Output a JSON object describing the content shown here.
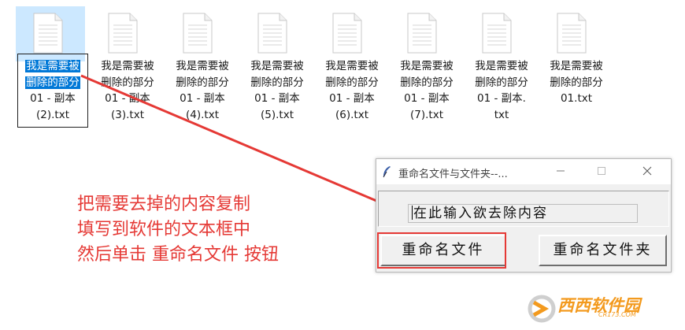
{
  "files": [
    {
      "lines": [
        "我是需要被",
        "删除的部分",
        "01 - 副本",
        "(2).txt"
      ],
      "selected": true
    },
    {
      "lines": [
        "我是需要被",
        "删除的部分",
        "01 - 副本",
        "(3).txt"
      ]
    },
    {
      "lines": [
        "我是需要被",
        "删除的部分",
        "01 - 副本",
        "(4).txt"
      ]
    },
    {
      "lines": [
        "我是需要被",
        "删除的部分",
        "01 - 副本",
        "(5).txt"
      ]
    },
    {
      "lines": [
        "我是需要被",
        "删除的部分",
        "01 - 副本",
        "(6).txt"
      ]
    },
    {
      "lines": [
        "我是需要被",
        "删除的部分",
        "01 - 副本",
        "(7).txt"
      ]
    },
    {
      "lines": [
        "我是需要被",
        "删除的部分",
        "01 - 副本.",
        "txt"
      ]
    },
    {
      "lines": [
        "我是需要被",
        "删除的部分",
        "01.txt"
      ]
    }
  ],
  "instructions": {
    "line1": "把需要去掉的内容复制",
    "line2": "填写到软件的文本框中",
    "line3": "然后单击 重命名文件 按钮"
  },
  "window": {
    "title": "重命名文件与文件夹--...",
    "minimize_icon": "minimize-icon",
    "maximize_icon": "maximize-icon",
    "close_icon": "close-icon",
    "input_value": "在此输入欲去除内容",
    "rename_file_label": "重命名文件",
    "rename_folder_label": "重命名文件夹"
  },
  "watermark": {
    "text": "西西软件园",
    "sub": "CR173.COM"
  },
  "colors": {
    "annotation_red": "#e53935",
    "selection_blue": "#0078d7",
    "selection_bg": "#cce8ff",
    "watermark_orange": "#f39a1e"
  }
}
